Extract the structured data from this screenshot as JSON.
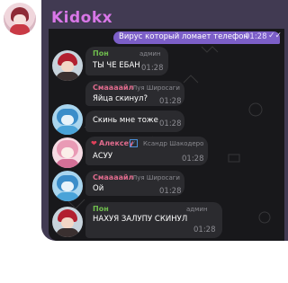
{
  "chat": {
    "title": "Kidokx"
  },
  "top_message": {
    "text": "Вирус который ломает телефон",
    "time": "01:28",
    "status_icon": "double-check-icon"
  },
  "messages": [
    {
      "sender": "Пон",
      "role": "админ",
      "text": "ТЫ ЧЕ ЕБАН",
      "time": "01:28",
      "sender_color": "#6fbd4d"
    },
    {
      "sender": "Смаааайл",
      "role": "Луя Широсаги",
      "text": "Яйца скинул?",
      "time": "01:28",
      "sender_color": "#e06b8d"
    },
    {
      "sender": "",
      "role": "",
      "text": "Скинь мне тоже",
      "time": "01:28",
      "sender_color": ""
    },
    {
      "sender": "Алексеу",
      "role": "Ксандр Шакодеро",
      "text": "АСУУ",
      "time": "01:28",
      "sender_color": "#e06b8d"
    },
    {
      "sender": "Смаааайл",
      "role": "Луя Широсаги",
      "text": "Ой",
      "time": "01:28",
      "sender_color": "#e06b8d"
    },
    {
      "sender": "Пон",
      "role": "админ",
      "text": "НАХУЯ ЗАЛУПУ СКИНУЛ",
      "time": "01:28",
      "sender_color": "#6fbd4d"
    }
  ]
}
